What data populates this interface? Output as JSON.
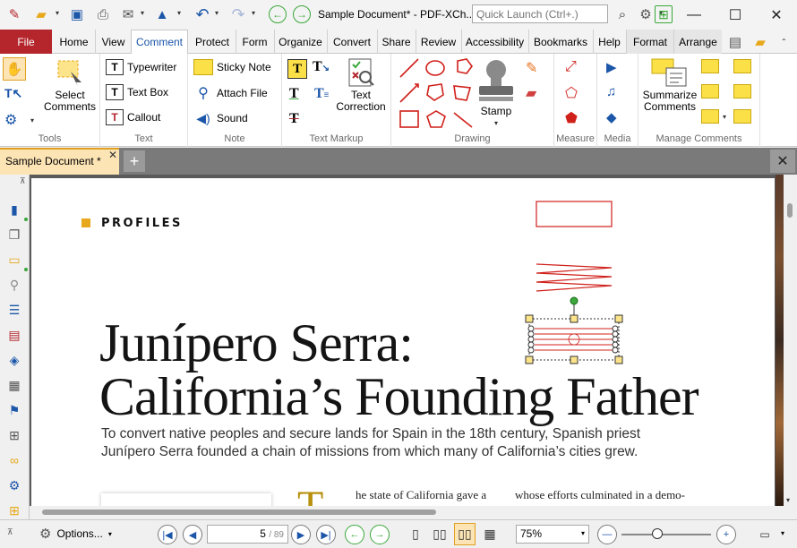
{
  "window": {
    "title": "Sample Document* - PDF-XCh...",
    "quick_launch_placeholder": "Quick Launch (Ctrl+.)"
  },
  "menu": {
    "items": [
      "File",
      "Home",
      "View",
      "Comment",
      "Protect",
      "Form",
      "Organize",
      "Convert",
      "Share",
      "Review",
      "Accessibility",
      "Bookmarks",
      "Help",
      "Format",
      "Arrange"
    ],
    "active": "Comment"
  },
  "ribbon": {
    "tools": {
      "label": "Tools",
      "select_comments": "Select\nComments"
    },
    "text": {
      "label": "Text",
      "typewriter": "Typewriter",
      "text_box": "Text Box",
      "callout": "Callout"
    },
    "note": {
      "label": "Note",
      "sticky_note": "Sticky Note",
      "attach_file": "Attach File",
      "sound": "Sound"
    },
    "text_markup": {
      "label": "Text Markup",
      "text_correction": "Text\nCorrection"
    },
    "drawing": {
      "label": "Drawing",
      "stamp": "Stamp"
    },
    "measure": {
      "label": "Measure"
    },
    "media": {
      "label": "Media"
    },
    "manage_comments": {
      "label": "Manage Comments",
      "summarize": "Summarize\nComments"
    }
  },
  "tabs": {
    "document_tab": "Sample Document *"
  },
  "document": {
    "section": "PROFILES",
    "heading_line1": "Junípero Serra:",
    "heading_line2": "California’s Founding Father",
    "subtitle_line1": "To convert native peoples and secure lands for Spain in the 18th century, Spanish priest",
    "subtitle_line2": "Junípero Serra founded a chain of missions from which many of California’s cities grew.",
    "dropcap": "T",
    "body_col1": "he state of California gave a",
    "body_col2": "whose efforts culminated in a demo-"
  },
  "status": {
    "options": "Options...",
    "page_current": "5",
    "page_total": "/ 89",
    "zoom": "75%"
  },
  "colors": {
    "file_tab": "#b4262c",
    "accent_blue": "#1b56a8",
    "tab_highlight": "#fce4b4",
    "annotation_red": "#d0201a",
    "profiles_square": "#e7a81b"
  }
}
